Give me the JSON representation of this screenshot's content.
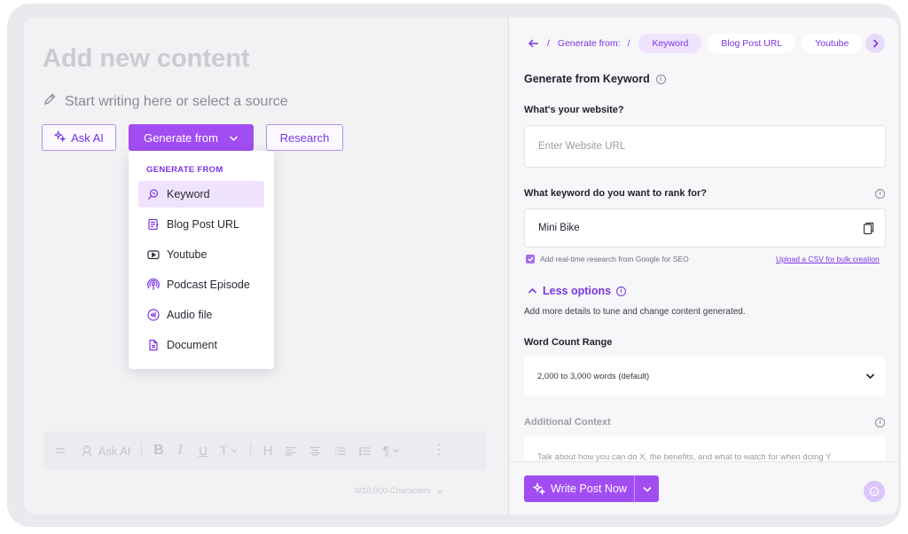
{
  "editor": {
    "title": "Add new content",
    "start_prompt": "Start writing here or select a source",
    "buttons": {
      "ask_ai": "Ask AI",
      "generate_from": "Generate from",
      "research": "Research"
    },
    "dropdown": {
      "header": "GENERATE FROM",
      "items": [
        {
          "label": "Keyword",
          "icon": "keyword-icon",
          "active": true
        },
        {
          "label": "Blog Post URL",
          "icon": "blog-post-icon"
        },
        {
          "label": "Youtube",
          "icon": "youtube-icon"
        },
        {
          "label": "Podcast Episode",
          "icon": "podcast-icon"
        },
        {
          "label": "Audio file",
          "icon": "audio-file-icon"
        },
        {
          "label": "Document",
          "icon": "document-icon"
        }
      ]
    },
    "toolbar": {
      "ask_ai": "Ask AI"
    },
    "char_count": "0/10,000 Characters"
  },
  "panel": {
    "breadcrumb": {
      "label": "Generate from:",
      "separator": "/",
      "tabs": [
        {
          "label": "Keyword",
          "active": true
        },
        {
          "label": "Blog Post URL"
        },
        {
          "label": "Youtube"
        }
      ]
    },
    "section_title": "Generate from Keyword",
    "website": {
      "label": "What's your website?",
      "placeholder": "Enter Website URL"
    },
    "keyword": {
      "label": "What keyword do you want to rank for?",
      "value": "Mini Bike"
    },
    "realtime_research": {
      "label": "Add real-time research from Google for SEO",
      "checked": true
    },
    "csv_link": "Upload a CSV for bulk creation",
    "less_options": "Less options",
    "helper_text": "Add more details to tune and change content generated.",
    "word_count": {
      "label": "Word Count Range",
      "value": "2,000 to 3,000 words (default)"
    },
    "additional_context": {
      "label": "Additional Context",
      "placeholder": "Talk about how you can do X, the benefits, and what to watch for when doing Y"
    },
    "write_button": "Write Post Now"
  },
  "colors": {
    "accent": "#a14df2",
    "accent_text": "#7b35e0",
    "accent_light": "#efe3fd"
  }
}
